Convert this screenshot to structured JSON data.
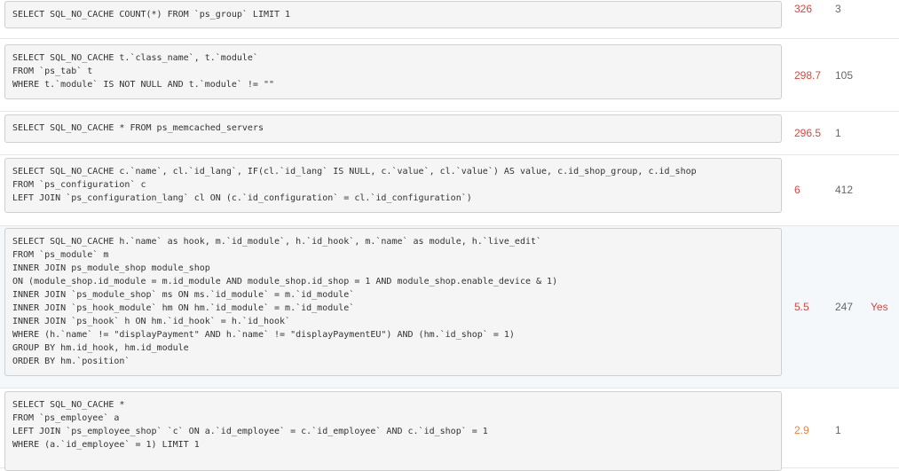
{
  "colors": {
    "time_high": "#d9463e",
    "time_medium": "#e8833a",
    "rows_text": "#666666",
    "index_yes": "#d9463e"
  },
  "queries": [
    {
      "sql": "SELECT SQL_NO_CACHE COUNT(*) FROM `ps_group` LIMIT 1",
      "time": "326",
      "time_level": "high",
      "rows": "3",
      "index": ""
    },
    {
      "sql": "SELECT SQL_NO_CACHE t.`class_name`, t.`module`\nFROM `ps_tab` t\nWHERE t.`module` IS NOT NULL AND t.`module` != \"\"",
      "time": "298.7",
      "time_level": "high",
      "rows": "105",
      "index": ""
    },
    {
      "sql": "SELECT SQL_NO_CACHE * FROM ps_memcached_servers",
      "time": "296.5",
      "time_level": "high",
      "rows": "1",
      "index": ""
    },
    {
      "sql": "SELECT SQL_NO_CACHE c.`name`, cl.`id_lang`, IF(cl.`id_lang` IS NULL, c.`value`, cl.`value`) AS value, c.id_shop_group, c.id_shop\nFROM `ps_configuration` c\nLEFT JOIN `ps_configuration_lang` cl ON (c.`id_configuration` = cl.`id_configuration`)",
      "time": "6",
      "time_level": "high",
      "rows": "412",
      "index": ""
    },
    {
      "sql": "SELECT SQL_NO_CACHE h.`name` as hook, m.`id_module`, h.`id_hook`, m.`name` as module, h.`live_edit`\nFROM `ps_module` m\nINNER JOIN ps_module_shop module_shop\nON (module_shop.id_module = m.id_module AND module_shop.id_shop = 1 AND module_shop.enable_device & 1)\nINNER JOIN `ps_module_shop` ms ON ms.`id_module` = m.`id_module`\nINNER JOIN `ps_hook_module` hm ON hm.`id_module` = m.`id_module`\nINNER JOIN `ps_hook` h ON hm.`id_hook` = h.`id_hook`\nWHERE (h.`name` != \"displayPayment\" AND h.`name` != \"displayPaymentEU\") AND (hm.`id_shop` = 1)\nGROUP BY hm.id_hook, hm.id_module\nORDER BY hm.`position`",
      "time": "5.5",
      "time_level": "high",
      "rows": "247",
      "index": "Yes"
    },
    {
      "sql": "SELECT SQL_NO_CACHE *\nFROM `ps_employee` a\nLEFT JOIN `ps_employee_shop` `c` ON a.`id_employee` = c.`id_employee` AND c.`id_shop` = 1\nWHERE (a.`id_employee` = 1) LIMIT 1",
      "time": "2.9",
      "time_level": "medium",
      "rows": "1",
      "index": ""
    }
  ]
}
